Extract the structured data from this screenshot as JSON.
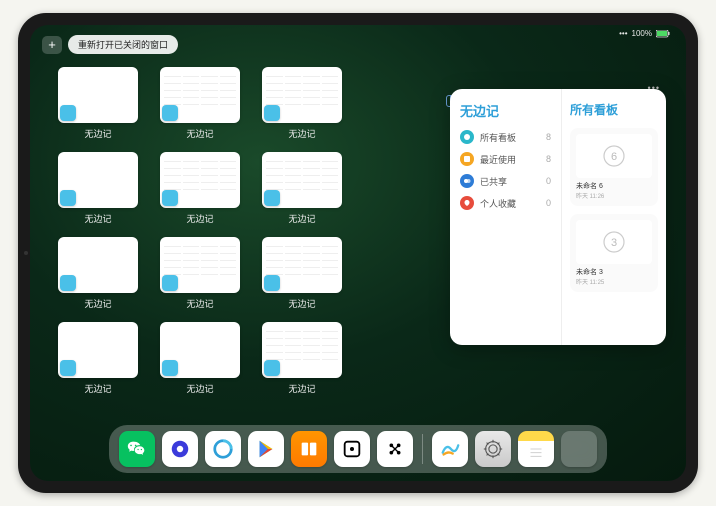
{
  "status": {
    "battery": "100%",
    "signal": "•••"
  },
  "topbar": {
    "plus": "+",
    "reopen_label": "重新打开已关闭的窗口"
  },
  "app_label": "无边记",
  "windows": [
    {
      "style": "blank"
    },
    {
      "style": "calendar"
    },
    {
      "style": "calendar"
    },
    {
      "style": "blank"
    },
    {
      "style": "calendar"
    },
    {
      "style": "calendar"
    },
    {
      "style": "blank"
    },
    {
      "style": "calendar"
    },
    {
      "style": "calendar"
    },
    {
      "style": "blank"
    },
    {
      "style": "blank"
    },
    {
      "style": "calendar"
    }
  ],
  "panel": {
    "left_title": "无边记",
    "menu": [
      {
        "label": "所有看板",
        "count": "8",
        "color": "#2ab7ca"
      },
      {
        "label": "最近使用",
        "count": "8",
        "color": "#f5a623"
      },
      {
        "label": "已共享",
        "count": "0",
        "color": "#2e7cd6"
      },
      {
        "label": "个人收藏",
        "count": "0",
        "color": "#e74c3c"
      }
    ],
    "right_title": "所有看板",
    "cards": [
      {
        "title": "未命名 6",
        "sub": "昨天 11:26",
        "digit": "6"
      },
      {
        "title": "未命名 3",
        "sub": "昨天 11:25",
        "digit": "3"
      }
    ],
    "dots": "•••"
  },
  "dock": [
    {
      "name": "wechat",
      "class": "di-wechat"
    },
    {
      "name": "quark",
      "class": "di-quark"
    },
    {
      "name": "qq-browser",
      "class": "di-qq"
    },
    {
      "name": "play-store",
      "class": "di-play"
    },
    {
      "name": "books",
      "class": "di-books"
    },
    {
      "name": "dice",
      "class": "di-tenc"
    },
    {
      "name": "custom-app",
      "class": "di-custom"
    },
    {
      "name": "sep"
    },
    {
      "name": "freeform",
      "class": "di-freeform"
    },
    {
      "name": "settings",
      "class": "di-settings"
    },
    {
      "name": "notes",
      "class": "di-notes"
    },
    {
      "name": "app-library",
      "class": "di-library"
    }
  ]
}
